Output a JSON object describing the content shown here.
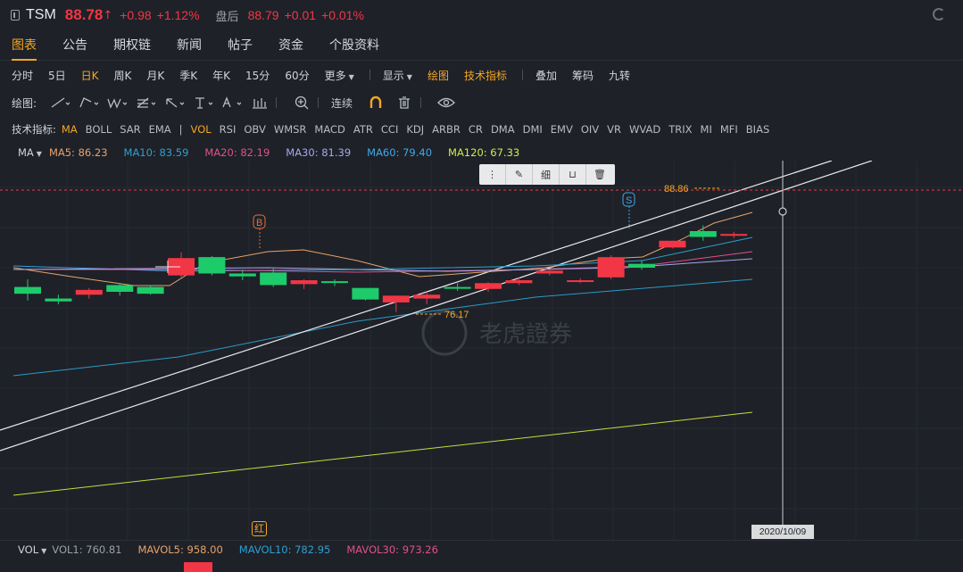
{
  "quote": {
    "symbol": "TSM",
    "price": "88.78",
    "arrow": "↑",
    "change": "+0.98",
    "change_pct": "+1.12%",
    "after_label": "盘后",
    "after_price": "88.79",
    "after_change": "+0.01",
    "after_pct": "+0.01%"
  },
  "tabs": [
    "图表",
    "公告",
    "期权链",
    "新闻",
    "帖子",
    "资金",
    "个股资料"
  ],
  "periods": [
    "分时",
    "5日",
    "日K",
    "周K",
    "月K",
    "季K",
    "年K",
    "15分",
    "60分",
    "更多"
  ],
  "view_opts": {
    "display": "显示",
    "draw": "绘图",
    "tech": "技术指标",
    "overlay": "叠加",
    "chips": "筹码",
    "nine": "九转"
  },
  "draw_bar": {
    "label": "绘图:",
    "continuous": "连续"
  },
  "indicators": {
    "label": "技术指标:",
    "main": [
      "MA",
      "BOLL",
      "SAR",
      "EMA"
    ],
    "sub": [
      "VOL",
      "RSI",
      "OBV",
      "WMSR",
      "MACD",
      "ATR",
      "CCI",
      "KDJ",
      "ARBR",
      "CR",
      "DMA",
      "DMI",
      "EMV",
      "OIV",
      "VR",
      "WVAD",
      "TRIX",
      "MI",
      "MFI",
      "BIAS"
    ]
  },
  "ma_legend": {
    "head": "MA",
    "items": [
      {
        "label": "MA5: 86.23",
        "color": "#e8a26a"
      },
      {
        "label": "MA10: 83.59",
        "color": "#2f9fd0"
      },
      {
        "label": "MA20: 82.19",
        "color": "#e0508a"
      },
      {
        "label": "MA30: 81.39",
        "color": "#a8a6f0"
      },
      {
        "label": "MA60: 79.40",
        "color": "#3fa9e8"
      },
      {
        "label": "MA120: 67.33",
        "color": "#d5e84a"
      }
    ]
  },
  "chart_annotations": {
    "high_label": "88.86",
    "low_label": "76.17",
    "buy_marker": "B",
    "sell_marker": "S",
    "date_tag": "2020/10/09",
    "red_marker": "红",
    "watermark": "老虎證券"
  },
  "drawing_toolbar": {
    "thin": "细"
  },
  "vol_legend": {
    "head": "VOL",
    "items": [
      {
        "label": "VOL1: 760.81",
        "color": "#9aa0a8"
      },
      {
        "label": "MAVOL5: 958.00",
        "color": "#e8a26a"
      },
      {
        "label": "MAVOL10: 782.95",
        "color": "#2f9fd0"
      },
      {
        "label": "MAVOL30: 973.26",
        "color": "#e0508a"
      }
    ]
  },
  "colors": {
    "up": "#f23645",
    "down": "#1ecb6b",
    "accent": "#f5a623",
    "bg": "#1e2128"
  },
  "candles": [
    {
      "o": 78.8,
      "h": 79.6,
      "l": 77.4,
      "c": 78.1
    },
    {
      "o": 77.6,
      "h": 78.0,
      "l": 77.0,
      "c": 77.3
    },
    {
      "o": 78.0,
      "h": 78.7,
      "l": 77.6,
      "c": 78.5
    },
    {
      "o": 79.0,
      "h": 79.2,
      "l": 77.9,
      "c": 78.3
    },
    {
      "o": 78.8,
      "h": 79.0,
      "l": 78.0,
      "c": 78.1
    },
    {
      "o": 80.0,
      "h": 82.4,
      "l": 79.8,
      "c": 81.8
    },
    {
      "o": 81.9,
      "h": 82.0,
      "l": 80.0,
      "c": 80.2
    },
    {
      "o": 80.2,
      "h": 80.6,
      "l": 79.5,
      "c": 79.9
    },
    {
      "o": 80.3,
      "h": 80.8,
      "l": 78.8,
      "c": 79.0
    },
    {
      "o": 79.1,
      "h": 79.6,
      "l": 78.6,
      "c": 79.5
    },
    {
      "o": 79.4,
      "h": 79.6,
      "l": 78.9,
      "c": 79.3
    },
    {
      "o": 78.7,
      "h": 78.7,
      "l": 77.4,
      "c": 77.5
    },
    {
      "o": 77.2,
      "h": 77.8,
      "l": 76.2,
      "c": 77.9
    },
    {
      "o": 77.6,
      "h": 78.3,
      "l": 77.0,
      "c": 78.0
    },
    {
      "o": 78.8,
      "h": 79.2,
      "l": 78.4,
      "c": 78.7
    },
    {
      "o": 78.6,
      "h": 79.3,
      "l": 78.3,
      "c": 79.2
    },
    {
      "o": 79.2,
      "h": 79.8,
      "l": 79.0,
      "c": 79.5
    },
    {
      "o": 80.2,
      "h": 80.6,
      "l": 80.0,
      "c": 80.5
    },
    {
      "o": 79.4,
      "h": 79.7,
      "l": 79.2,
      "c": 79.5
    },
    {
      "o": 79.8,
      "h": 82.1,
      "l": 79.6,
      "c": 81.9
    },
    {
      "o": 81.2,
      "h": 81.6,
      "l": 80.6,
      "c": 80.8
    },
    {
      "o": 82.9,
      "h": 83.6,
      "l": 82.8,
      "c": 83.6
    },
    {
      "o": 84.6,
      "h": 85.2,
      "l": 83.6,
      "c": 84.0
    },
    {
      "o": 84.2,
      "h": 84.5,
      "l": 83.9,
      "c": 84.3
    }
  ]
}
